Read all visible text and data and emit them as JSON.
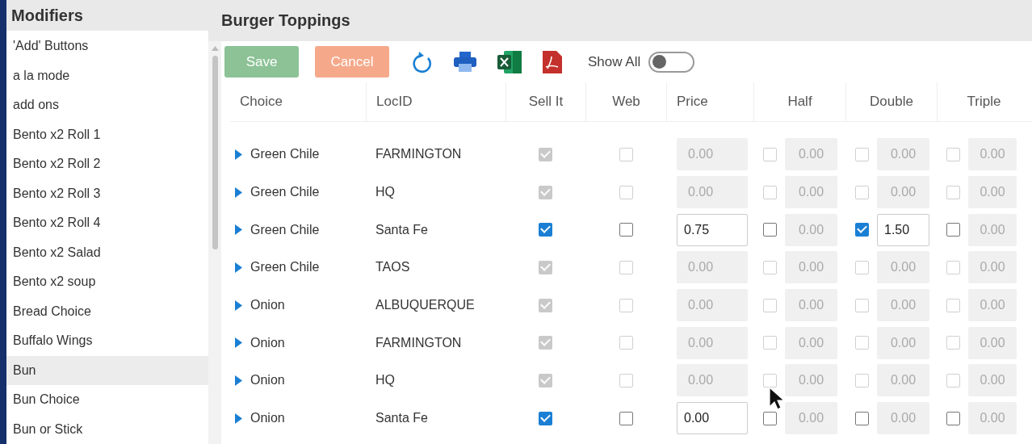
{
  "sidebar": {
    "title": "Modifiers",
    "items": [
      {
        "label": "'Add' Buttons",
        "selected": false
      },
      {
        "label": "a la mode",
        "selected": false
      },
      {
        "label": "add ons",
        "selected": false
      },
      {
        "label": "Bento x2 Roll 1",
        "selected": false
      },
      {
        "label": "Bento x2 Roll 2",
        "selected": false
      },
      {
        "label": "Bento x2 Roll 3",
        "selected": false
      },
      {
        "label": "Bento x2 Roll 4",
        "selected": false
      },
      {
        "label": "Bento x2 Salad",
        "selected": false
      },
      {
        "label": "Bento x2 soup",
        "selected": false
      },
      {
        "label": "Bread Choice",
        "selected": false
      },
      {
        "label": "Buffalo Wings",
        "selected": false
      },
      {
        "label": "Bun",
        "selected": true
      },
      {
        "label": "Bun Choice",
        "selected": false
      },
      {
        "label": "Bun or Stick",
        "selected": false
      }
    ]
  },
  "main": {
    "title": "Burger Toppings",
    "toolbar": {
      "buttons": [
        {
          "label": "Save",
          "kind": "save"
        },
        {
          "label": "Cancel",
          "kind": "cancel"
        }
      ],
      "show_all": {
        "label": "Show All",
        "on": false
      }
    },
    "table": {
      "columns": [
        "Choice",
        "LocID",
        "Sell It",
        "Web",
        "Price",
        "Half",
        "Double",
        "Triple"
      ],
      "rows": [
        {
          "choice": "Green Chile",
          "loc": "FARMINGTON",
          "disabled": true,
          "sell_it": true,
          "web": false,
          "price": "0.00",
          "half": {
            "checked": false,
            "value": "0.00"
          },
          "double": {
            "checked": false,
            "value": "0.00"
          },
          "triple": {
            "checked": false,
            "value": "0.00"
          }
        },
        {
          "choice": "Green Chile",
          "loc": "HQ",
          "disabled": true,
          "sell_it": true,
          "web": false,
          "price": "0.00",
          "half": {
            "checked": false,
            "value": "0.00"
          },
          "double": {
            "checked": false,
            "value": "0.00"
          },
          "triple": {
            "checked": false,
            "value": "0.00"
          }
        },
        {
          "choice": "Green Chile",
          "loc": "Santa Fe",
          "disabled": false,
          "sell_it": true,
          "web": false,
          "price": "0.75",
          "half": {
            "checked": false,
            "value": "0.00"
          },
          "double": {
            "checked": true,
            "value": "1.50"
          },
          "triple": {
            "checked": false,
            "value": "0.00"
          }
        },
        {
          "choice": "Green Chile",
          "loc": "TAOS",
          "disabled": true,
          "sell_it": true,
          "web": false,
          "price": "0.00",
          "half": {
            "checked": false,
            "value": "0.00"
          },
          "double": {
            "checked": false,
            "value": "0.00"
          },
          "triple": {
            "checked": false,
            "value": "0.00"
          }
        },
        {
          "choice": "Onion",
          "loc": "ALBUQUERQUE",
          "disabled": true,
          "sell_it": true,
          "web": false,
          "price": "0.00",
          "half": {
            "checked": false,
            "value": "0.00"
          },
          "double": {
            "checked": false,
            "value": "0.00"
          },
          "triple": {
            "checked": false,
            "value": "0.00"
          }
        },
        {
          "choice": "Onion",
          "loc": "FARMINGTON",
          "disabled": true,
          "sell_it": true,
          "web": false,
          "price": "0.00",
          "half": {
            "checked": false,
            "value": "0.00"
          },
          "double": {
            "checked": false,
            "value": "0.00"
          },
          "triple": {
            "checked": false,
            "value": "0.00"
          }
        },
        {
          "choice": "Onion",
          "loc": "HQ",
          "disabled": true,
          "sell_it": true,
          "web": false,
          "price": "0.00",
          "half": {
            "checked": false,
            "value": "0.00"
          },
          "double": {
            "checked": false,
            "value": "0.00"
          },
          "triple": {
            "checked": false,
            "value": "0.00"
          }
        },
        {
          "choice": "Onion",
          "loc": "Santa Fe",
          "disabled": false,
          "sell_it": true,
          "web": false,
          "price": "0.00",
          "half": {
            "checked": false,
            "value": "0.00"
          },
          "double": {
            "checked": false,
            "value": "0.00"
          },
          "triple": {
            "checked": false,
            "value": "0.00"
          }
        }
      ]
    }
  }
}
